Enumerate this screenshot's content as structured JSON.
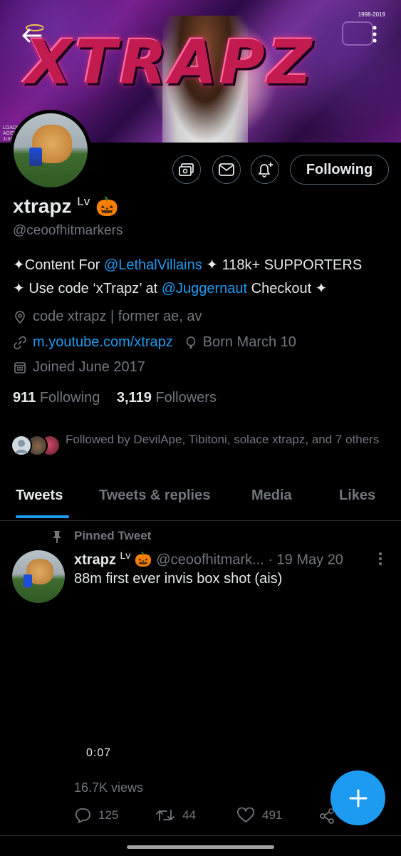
{
  "banner": {
    "art_text": "XTRAPZ",
    "year_text": "1998-2019",
    "loading_text": [
      "LOADI",
      "AGEN",
      "JUICI"
    ]
  },
  "header": {
    "back_label": "Back",
    "more_label": "More"
  },
  "actions": {
    "following_label": "Following"
  },
  "profile": {
    "name": "xtrapz",
    "name_badge": "Lv",
    "name_emoji": "🎃",
    "handle": "@ceoofhitmarkers",
    "bio_line1_prefix": "✦Content For ",
    "bio_line1_link": "@LethalVillains",
    "bio_line1_suffix": " ✦ 118k+ SUPPORTERS",
    "bio_line2_prefix": "✦ Use code ‘xTrapz’ at ",
    "bio_line2_link": "@Juggernaut",
    "bio_line2_suffix": " Checkout ✦",
    "location": "code xtrapz | former ae, av",
    "website": "m.youtube.com/xtrapz",
    "birthday": "Born March 10",
    "joined": "Joined June 2017",
    "following_count": "911",
    "following_label": "Following",
    "followers_count": "3,119",
    "followers_label": "Followers",
    "followed_by": "Followed by DevilApe, Tibitoni, solace xtrapz, and 7 others"
  },
  "tabs": [
    {
      "label": "Tweets",
      "active": true
    },
    {
      "label": "Tweets & replies",
      "active": false
    },
    {
      "label": "Media",
      "active": false
    },
    {
      "label": "Likes",
      "active": false
    }
  ],
  "tweet": {
    "pinned_label": "Pinned Tweet",
    "author_name": "xtrapz",
    "author_badge": "Lv",
    "author_emoji": "🎃",
    "author_handle": "@ceoofhitmark...",
    "date": "· 19 May 20",
    "text": "88m first ever invis box shot (ais)",
    "video_duration": "0:07",
    "views": "16.7K views",
    "replies": "125",
    "retweets": "44",
    "likes": "491"
  },
  "colors": {
    "accent": "#1d9bf0",
    "text": "#e7e9ea",
    "muted": "#71767b",
    "background": "#000000"
  }
}
